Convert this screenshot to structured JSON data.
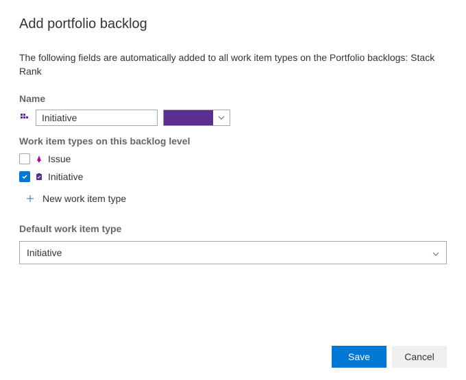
{
  "title": "Add portfolio backlog",
  "description": "The following fields are automatically added to all work item types on the Portfolio backlogs: Stack Rank",
  "name": {
    "label": "Name",
    "value": "Initiative",
    "color": "#5c2d91"
  },
  "workItemTypes": {
    "label": "Work item types on this backlog level",
    "items": [
      {
        "label": "Issue",
        "checked": false,
        "icon": "issue",
        "iconColor": "#b4009e"
      },
      {
        "label": "Initiative",
        "checked": true,
        "icon": "clipboard",
        "iconColor": "#5c2d91"
      }
    ],
    "addLabel": "New work item type"
  },
  "defaultWorkItemType": {
    "label": "Default work item type",
    "selected": "Initiative"
  },
  "buttons": {
    "save": "Save",
    "cancel": "Cancel"
  }
}
